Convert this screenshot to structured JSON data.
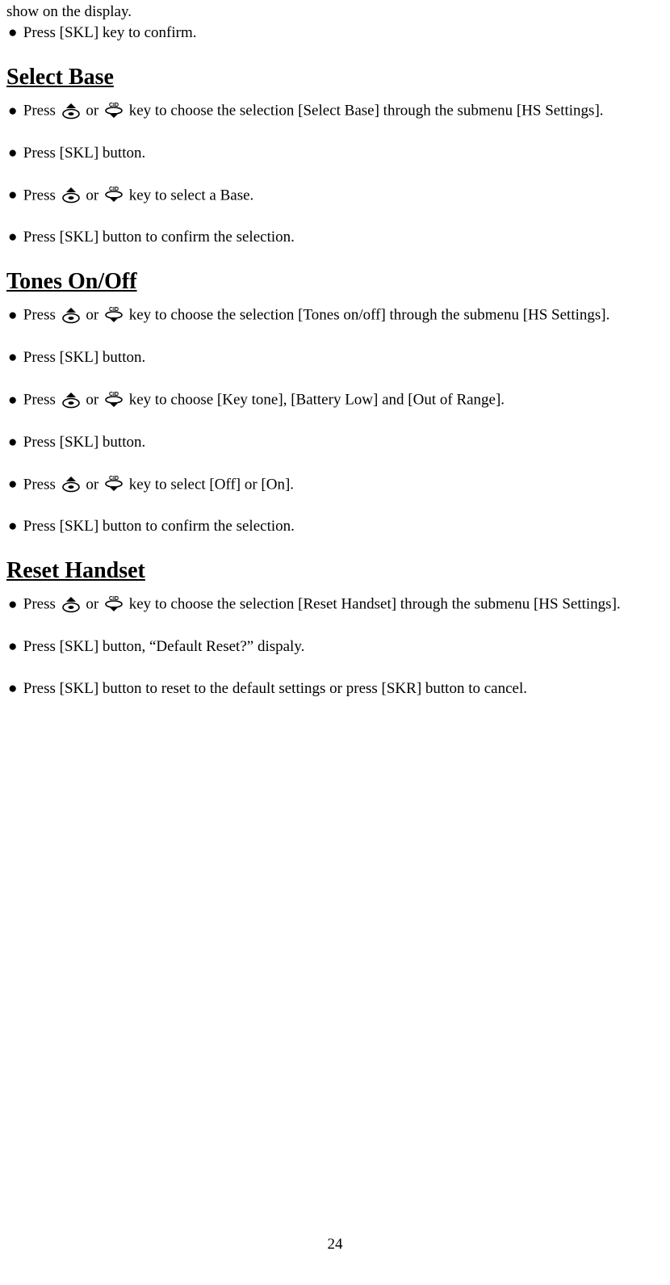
{
  "intro": {
    "line1": "show on the display.",
    "line2_before": "Press [SKL]",
    "line2_after": "key to confirm."
  },
  "sections": [
    {
      "heading": "Select Base",
      "items": [
        {
          "type": "updown",
          "before": "Press ",
          "mid": " or ",
          "after": " key to choose the selection [Select Base] through the submenu [HS Settings]."
        },
        {
          "type": "plain",
          "text": "Press [SKL] button."
        },
        {
          "type": "updown",
          "before": "Press ",
          "mid": " or ",
          "after": " key to select a Base."
        },
        {
          "type": "plain",
          "text": "Press [SKL] button to confirm the selection.",
          "tight": true
        }
      ]
    },
    {
      "heading": "Tones On/Off",
      "items": [
        {
          "type": "updown",
          "before": "Press ",
          "mid": " or ",
          "after": " key to choose the selection [Tones on/off] through the submenu [HS Settings]."
        },
        {
          "type": "plain",
          "text": "Press [SKL] button."
        },
        {
          "type": "updown",
          "before": "Press ",
          "mid": " or ",
          "after": " key to choose [Key tone], [Battery Low] and [Out of Range]."
        },
        {
          "type": "plain",
          "text": "Press [SKL] button."
        },
        {
          "type": "updown",
          "before": "Press ",
          "mid": " or ",
          "after": " key to select [Off] or [On]."
        },
        {
          "type": "plain",
          "text": "Press [SKL] button to confirm the selection.",
          "tight": true
        }
      ]
    },
    {
      "heading": "Reset Handset",
      "items": [
        {
          "type": "updown",
          "before": "Press ",
          "mid": " or ",
          "after": " key to choose the selection [Reset Handset] through the submenu [HS Settings]."
        },
        {
          "type": "plain",
          "text": "Press [SKL] button, “Default Reset?” dispaly."
        },
        {
          "type": "plain",
          "text": "Press [SKL] button to reset to the default settings or press [SKR] button to cancel."
        }
      ]
    }
  ],
  "page_number": "24",
  "bullet_char": "●"
}
